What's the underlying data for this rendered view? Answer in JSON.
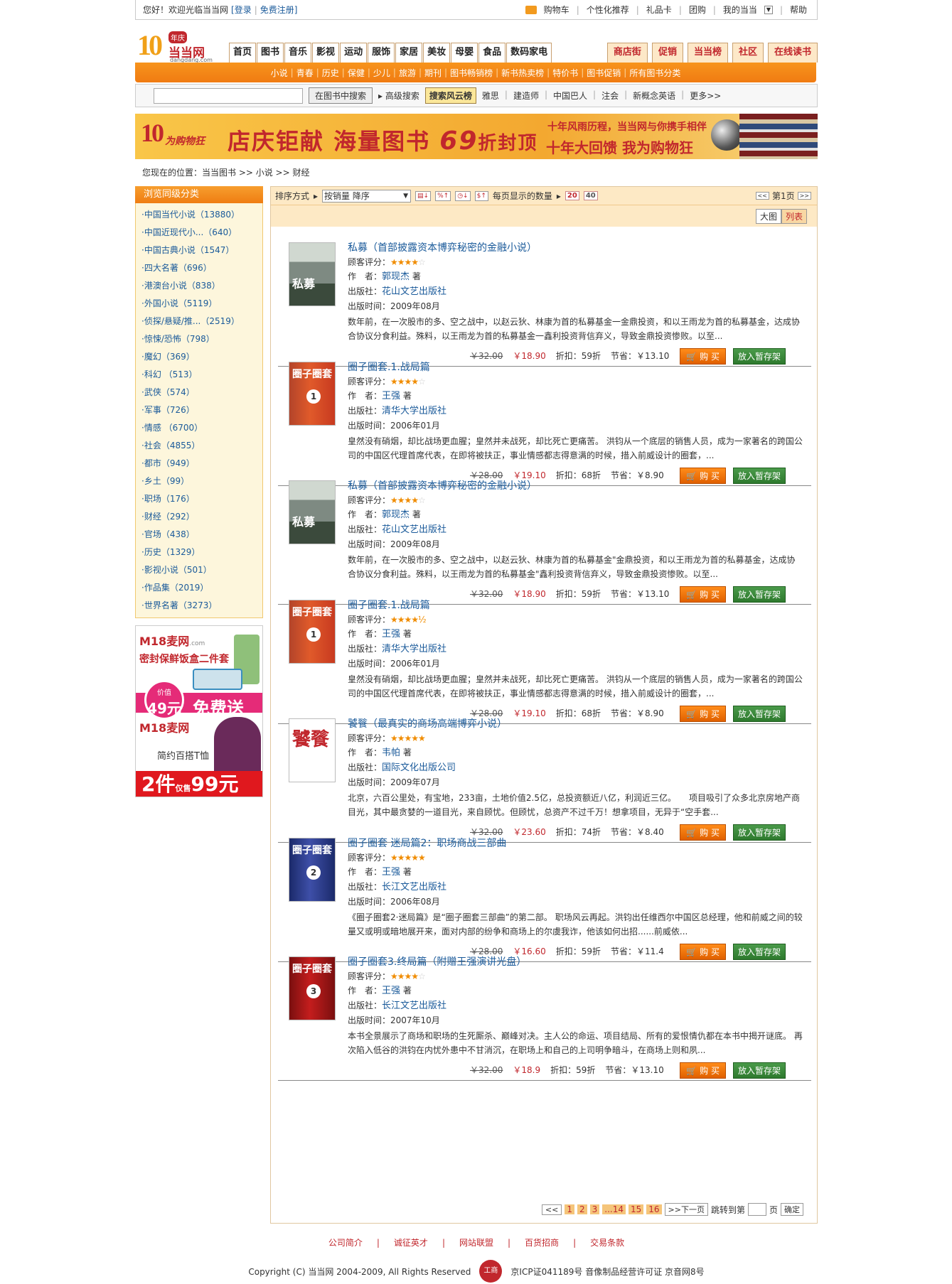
{
  "topbar": {
    "welcome": "您好！欢迎光临当当网",
    "login": "[登录",
    "register": "免费注册]",
    "cart": "购物车",
    "personal": "个性化推荐",
    "gift": "礼品卡",
    "group": "团购",
    "mydd": "我的当当",
    "help": "帮助"
  },
  "logo": {
    "ten": "10",
    "nian": "年庆",
    "name": "当当网",
    "domain": "dangdang.com"
  },
  "nav": [
    "首页",
    "图书",
    "音乐",
    "影视",
    "运动",
    "服饰",
    "家居",
    "美妆",
    "母婴",
    "食品",
    "数码家电"
  ],
  "rnav": [
    "商店街",
    "促销",
    "当当榜",
    "社区",
    "在线读书"
  ],
  "subnav": [
    "小说",
    "青春",
    "历史",
    "保健",
    "少儿",
    "旅游",
    "期刊",
    "图书畅销榜",
    "新书热卖榜",
    "特价书",
    "图书促销",
    "所有图书分类"
  ],
  "search": {
    "button": "在图书中搜索",
    "advanced": "高级搜索",
    "cloud": "搜索风云榜",
    "hot": [
      "雅思",
      "建造师",
      "中国巴人",
      "注会",
      "新概念英语",
      "更多>>"
    ]
  },
  "banner": {
    "logo": "10",
    "logo_sub": "为购物狂",
    "headline": "店庆钜献  海量图书",
    "num": "69",
    "suffix": "折封顶",
    "line1": "十年风雨历程，当当网与你携手相伴",
    "line2": "十年大回馈  我为购物狂"
  },
  "breadcrumb": "您现在的位置：当当图书 >> 小说 >> 财经",
  "sidebar": {
    "title": "浏览同级分类",
    "items": [
      "·中国当代小说（13880）",
      "·中国近现代小...（640）",
      "·中国古典小说（1547）",
      "·四大名著（696）",
      "·港澳台小说（838）",
      "·外国小说（5119）",
      "·侦探/悬疑/推...（2519）",
      "·惊悚/恐怖（798）",
      "·魔幻（369）",
      "·科幻 （513）",
      "·武侠（574）",
      "·军事（726）",
      "·情感 （6700）",
      "·社会（4855）",
      "·都市（949）",
      "·乡土（99）",
      "·职场（176）",
      "·财经（292）",
      "·官场（438）",
      "·历史（1329）",
      "·影视小说（501）",
      "·作品集（2019）",
      "·世界名著（3273）"
    ]
  },
  "ad": {
    "brand": "M18麦网",
    "dom": ".com",
    "title": "密封保鲜饭盒二件套",
    "price_label": "价值",
    "price": "49元",
    "free": "免费送",
    "brand2": "M18麦网",
    "title2": "简约百搭T恤",
    "promo": "2件",
    "promo_small": "仅售",
    "promo_price": "99元"
  },
  "sortbar": {
    "label": "排序方式",
    "selected": "按销量  降序",
    "per_page": "每页显示的数量",
    "n20": "20",
    "n40": "40",
    "page": "第1页"
  },
  "view": {
    "grid": "大图",
    "list": "列表"
  },
  "labels": {
    "rating": "顾客评分：",
    "author": "作　者：",
    "publisher": "出版社：",
    "date": "出版时间：",
    "discount": "折扣：",
    "save": "节省：",
    "buy": "购 买",
    "fav": "放入暂存架",
    "suffix": "著"
  },
  "products": [
    {
      "title": "私募（首部披露资本博弈秘密的金融小说）",
      "stars": "★★★★",
      "estars": "☆",
      "author": "郭现杰",
      "publisher": "花山文艺出版社",
      "date": "2009年08月",
      "desc": "数年前，在一次股市的多、空之战中，以赵云狄、林康为首的私募基金一金鼎投资，和以王雨龙为首的私募基金，达成协合协议分食利益。殊料，以王雨龙为首的私募基金一鑫利投资背信弃义，导致金鼎投资惨败。以至...",
      "old": "￥32.00",
      "new": "￥18.90",
      "discount": "59折",
      "save": "￥13.10",
      "cover": "私募"
    },
    {
      "title": "圈子圈套.1.战局篇",
      "stars": "★★★★",
      "estars": "☆",
      "author": "王强",
      "publisher": "清华大学出版社",
      "date": "2006年01月",
      "desc": "皇然没有硝烟，却比战场更血腥；皇然并未战死，却比死亡更痛苦。 洪钧从一个底层的销售人员，成为一家著名的跨国公司的中国区代理首席代表，在即将被扶正，事业情感都志得意满的时候，措入前威设计的圈套，...",
      "old": "￥28.00",
      "new": "￥19.10",
      "discount": "68折",
      "save": "￥8.90",
      "cover": "圈子圈套"
    },
    {
      "title": "私募（首部披露资本博弈秘密的金融小说）",
      "stars": "★★★★",
      "estars": "☆",
      "author": "郭现杰",
      "publisher": "花山文艺出版社",
      "date": "2009年08月",
      "desc": "数年前，在一次股市的多、空之战中，以赵云狄、林康为首的私募基金\"金鼎投资，和以王雨龙为首的私募基金，达成协合协议分食利益。殊料，以王雨龙为首的私募基金\"鑫利投资背信弃义，导致金鼎投资惨败。以至...",
      "old": "￥32.00",
      "new": "￥18.90",
      "discount": "59折",
      "save": "￥13.10",
      "cover": "私募"
    },
    {
      "title": "圈子圈套.1.战局篇",
      "stars": "★★★★½",
      "estars": "",
      "author": "王强",
      "publisher": "清华大学出版社",
      "date": "2006年01月",
      "desc": "皇然没有硝烟，却比战场更血腥；皇然并未战死，却比死亡更痛苦。 洪钧从一个底层的销售人员，成为一家著名的跨国公司的中国区代理首席代表，在即将被扶正，事业情感都志得意满的时候，措入前威设计的圈套，...",
      "old": "￥28.00",
      "new": "￥19.10",
      "discount": "68折",
      "save": "￥8.90",
      "cover": "圈子圈套"
    },
    {
      "title": "饕餮（最真实的商场高端博弈小说）",
      "stars": "★★★★★",
      "estars": "",
      "author": "韦帕",
      "publisher": "国际文化出版公司",
      "date": "2009年07月",
      "desc": "北京，六百公里处，有宝地，233亩，土地价值2.5亿，总投资额近八亿，利润近三亿。　　项目吸引了众多北京房地产商目光，其中最贪婪的一道目光，来自顾忧。但顾忧，总资产不过千万！想拿项目，无异于“空手套...",
      "old": "￥32.00",
      "new": "￥23.60",
      "discount": "74折",
      "save": "￥8.40",
      "cover": "饕餮"
    },
    {
      "title": "圈子圈套 迷局篇2：职场商战三部曲",
      "stars": "★★★★★",
      "estars": "",
      "author": "王强",
      "publisher": "长江文艺出版社",
      "date": "2006年08月",
      "desc": "《圈子圈套2·迷局篇》是“圈子圈套三部曲”的第二部。 职场风云再起。洪钧出任维西尔中国区总经理，他和前威之间的较量又或明或暗地展开来，面对内部的纷争和商场上的尔虞我诈，他该如何出招......前威依...",
      "old": "￥28.00",
      "new": "￥16.60",
      "discount": "59折",
      "save": "￥11.4",
      "cover": "圈子圈套"
    },
    {
      "title": "圈子圈套3.终局篇（附赠王强演讲光盘）",
      "stars": "★★★★",
      "estars": "☆",
      "author": "王强",
      "publisher": "长江文艺出版社",
      "date": "2007年10月",
      "desc": "本书全景展示了商场和职场的生死厮杀、巅峰对决。主人公的命运、项目结局、所有的爱恨情仇都在本书中揭开谜底。 再次陷入低谷的洪钧在内忧外患中不甘消沉，在职场上和自己的上司明争暗斗，在商场上则和夙...",
      "old": "￥32.00",
      "new": "￥18.9",
      "discount": "59折",
      "save": "￥13.10",
      "cover": "圈子圈套"
    }
  ],
  "pager": {
    "pages": [
      "1",
      "2",
      "3",
      "...14",
      "15",
      "16"
    ],
    "next": ">>下一页",
    "jump": "跳转到第",
    "unit": "页",
    "ok": "确定"
  },
  "footer": {
    "links": [
      "公司简介",
      "诚征英才",
      "网站联盟",
      "百货招商",
      "交易条款"
    ],
    "copy": "Copyright (C) 当当网 2004-2009, All Rights Reserved",
    "badge": "工商",
    "icp": "京ICP证041189号 音像制品经营许可证 京音网8号"
  }
}
